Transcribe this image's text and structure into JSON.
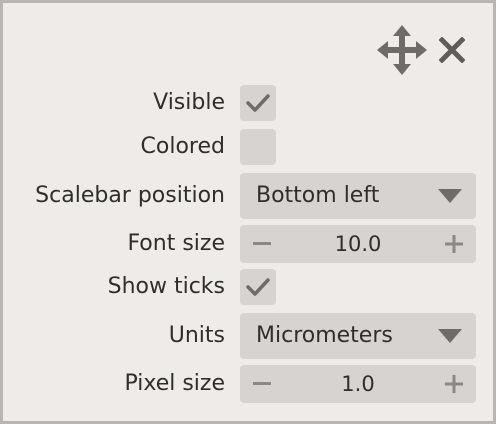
{
  "window": {
    "move_icon": "move-icon",
    "close_icon": "close-icon"
  },
  "fields": {
    "visible": {
      "label": "Visible",
      "checked": true
    },
    "colored": {
      "label": "Colored",
      "checked": false
    },
    "scalebar_position": {
      "label": "Scalebar position",
      "value": "Bottom left"
    },
    "font_size": {
      "label": "Font size",
      "value": "10.0"
    },
    "show_ticks": {
      "label": "Show ticks",
      "checked": true
    },
    "units": {
      "label": "Units",
      "value": "Micrometers"
    },
    "pixel_size": {
      "label": "Pixel size",
      "value": "1.0"
    }
  },
  "colors": {
    "panel_bg": "#efebe8",
    "control_bg": "#d7d3d0",
    "icon": "#6e6b69",
    "text": "#2e2e2e"
  }
}
